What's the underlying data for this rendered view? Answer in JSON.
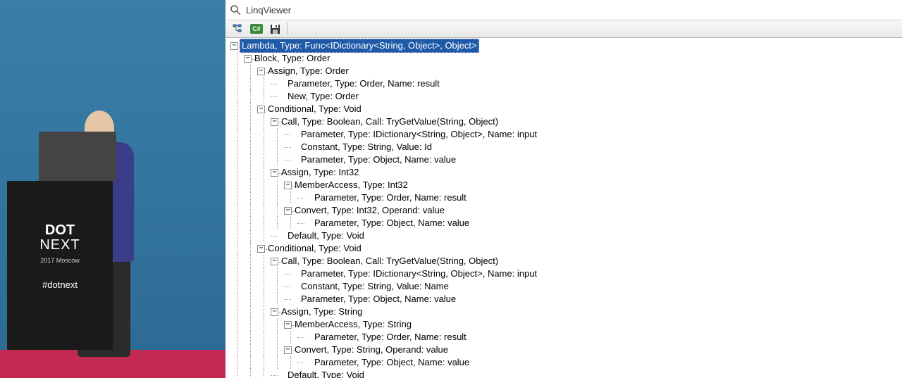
{
  "title": "LinqViewer",
  "conference": {
    "line1": "DOT",
    "line2": "NEXT",
    "sub": "2017 Moscow",
    "hashtag": "#dotnext"
  },
  "toolbar": {
    "tree_btn": "tree",
    "csharp_btn": "C#",
    "save_btn": "save"
  },
  "tree": [
    {
      "depth": 0,
      "exp": "-",
      "text": "Lambda, Type: Func<IDictionary<String, Object>, Object>",
      "selected": true
    },
    {
      "depth": 1,
      "exp": "-",
      "text": "Block, Type: Order"
    },
    {
      "depth": 2,
      "exp": "-",
      "text": "Assign, Type: Order"
    },
    {
      "depth": 3,
      "exp": "",
      "text": "Parameter, Type: Order, Name: result"
    },
    {
      "depth": 3,
      "exp": "",
      "text": "New, Type: Order"
    },
    {
      "depth": 2,
      "exp": "-",
      "text": "Conditional, Type: Void"
    },
    {
      "depth": 3,
      "exp": "-",
      "text": "Call, Type: Boolean, Call: TryGetValue(String, Object)"
    },
    {
      "depth": 4,
      "exp": "",
      "text": "Parameter, Type: IDictionary<String, Object>, Name: input"
    },
    {
      "depth": 4,
      "exp": "",
      "text": "Constant, Type: String, Value: Id"
    },
    {
      "depth": 4,
      "exp": "",
      "text": "Parameter, Type: Object, Name: value"
    },
    {
      "depth": 3,
      "exp": "-",
      "text": "Assign, Type: Int32"
    },
    {
      "depth": 4,
      "exp": "-",
      "text": "MemberAccess, Type: Int32"
    },
    {
      "depth": 5,
      "exp": "",
      "text": "Parameter, Type: Order, Name: result"
    },
    {
      "depth": 4,
      "exp": "-",
      "text": "Convert, Type: Int32, Operand: value"
    },
    {
      "depth": 5,
      "exp": "",
      "text": "Parameter, Type: Object, Name: value"
    },
    {
      "depth": 3,
      "exp": "",
      "text": "Default, Type: Void"
    },
    {
      "depth": 2,
      "exp": "-",
      "text": "Conditional, Type: Void"
    },
    {
      "depth": 3,
      "exp": "-",
      "text": "Call, Type: Boolean, Call: TryGetValue(String, Object)"
    },
    {
      "depth": 4,
      "exp": "",
      "text": "Parameter, Type: IDictionary<String, Object>, Name: input"
    },
    {
      "depth": 4,
      "exp": "",
      "text": "Constant, Type: String, Value: Name"
    },
    {
      "depth": 4,
      "exp": "",
      "text": "Parameter, Type: Object, Name: value"
    },
    {
      "depth": 3,
      "exp": "-",
      "text": "Assign, Type: String"
    },
    {
      "depth": 4,
      "exp": "-",
      "text": "MemberAccess, Type: String"
    },
    {
      "depth": 5,
      "exp": "",
      "text": "Parameter, Type: Order, Name: result"
    },
    {
      "depth": 4,
      "exp": "-",
      "text": "Convert, Type: String, Operand: value"
    },
    {
      "depth": 5,
      "exp": "",
      "text": "Parameter, Type: Object, Name: value"
    },
    {
      "depth": 3,
      "exp": "",
      "text": "Default, Type: Void"
    }
  ]
}
